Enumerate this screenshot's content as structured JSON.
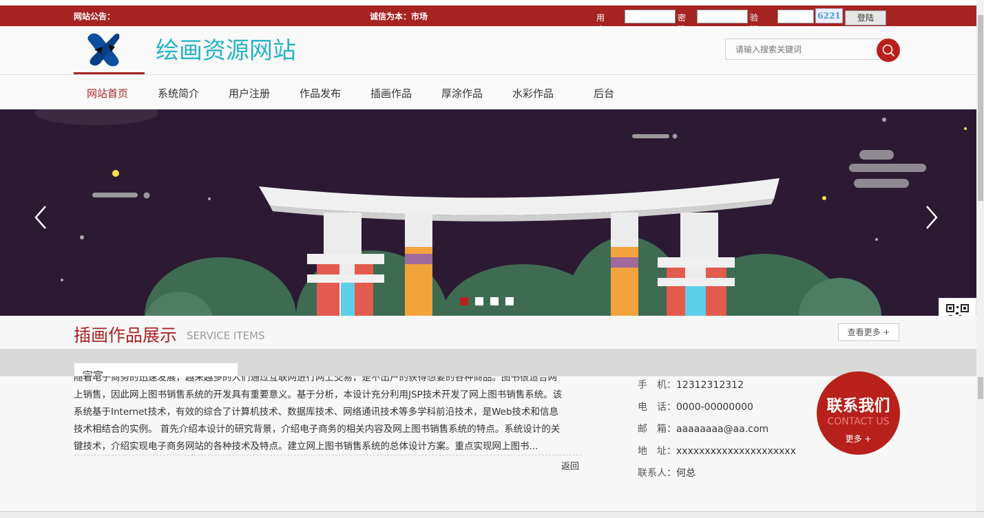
{
  "topbar": {
    "notice_label": "网站公告：",
    "motto": "诚信为本：市场",
    "username_label": "用户名",
    "password_label": "密码",
    "captcha_label": "验证码",
    "captcha_code": "6221",
    "login_button": "登陆"
  },
  "header": {
    "site_title": "绘画资源网站",
    "search_placeholder": "请输入搜索关键词",
    "search_icon": "search-icon"
  },
  "nav": {
    "items": [
      "网站首页",
      "系统简介",
      "用户注册",
      "作品发布",
      "插画作品",
      "厚涂作品",
      "水彩作品",
      "后台"
    ],
    "active_index": 0
  },
  "banner": {
    "prev_icon": "chevron-left-icon",
    "next_icon": "chevron-right-icon",
    "slide_count": 4,
    "active_slide": 1
  },
  "section": {
    "title": "插画作品展示",
    "subtitle": "SERVICE ITEMS",
    "more_button": "查看更多 +"
  },
  "intro": {
    "tab_label": "宗宣",
    "lines": [
      "随着电子商务的迅速发展，越来越多的人们通过互联网进行网上交易，是不出户的获得想要的各种商品。图书很适合网",
      "上销售，因此网上图书销售系统的开发具有重要意义。基于分析，本设计充分利用JSP技术开发了网上图书销售系统。该",
      "系统基于Internet技术，有效的综合了计算机技术、数据库技术、网络通讯技术等多学科前沿技术，是Web技术和信息",
      "技术相结合的实例。 首先介绍本设计的研究背景，介绍电子商务的相关内容及网上图书销售系统的特点。系统设计的关",
      "键技术，介绍实现电子商务网站的各种技术及特点。建立网上图书销售系统的总体设计方案。重点实现网上图书..."
    ],
    "back_link": "返回"
  },
  "contact": {
    "mobile_label": "手　机：",
    "mobile": "12312312312",
    "phone_label": "电　话：",
    "phone": "0000-00000000",
    "email_label": "邮　箱：",
    "email": "aaaaaaaa@aa.com",
    "address_label": "地　址：",
    "address": "xxxxxxxxxxxxxxxxxxxxx",
    "person_label": "联系人：",
    "person": "何总",
    "badge_title": "联系我们",
    "badge_sub": "CONTACT US",
    "badge_more": "更多 +"
  },
  "colors": {
    "brand_red": "#a52422",
    "accent_teal": "#27b3c8",
    "banner_bg": "#2c1a33"
  }
}
